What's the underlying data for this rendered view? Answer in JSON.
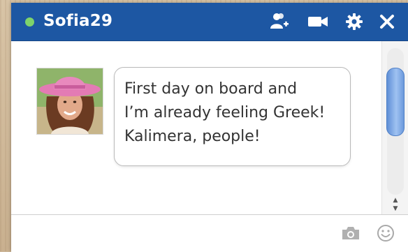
{
  "chat": {
    "username": "Sofia29",
    "status": "online",
    "colors": {
      "titlebar": "#1d57a3",
      "status_online": "#7ed36b",
      "scroll_thumb": "#7aa7e6"
    },
    "header_icons": [
      "add-friend-icon",
      "video-call-icon",
      "settings-gear-icon",
      "close-icon"
    ],
    "message": {
      "sender_avatar": "avatar",
      "text": "First day on board and\nI’m already feeling Greek!\nKalimera, people!"
    },
    "composer": {
      "input_value": "",
      "icons": [
        "camera-icon",
        "smiley-icon"
      ]
    }
  }
}
